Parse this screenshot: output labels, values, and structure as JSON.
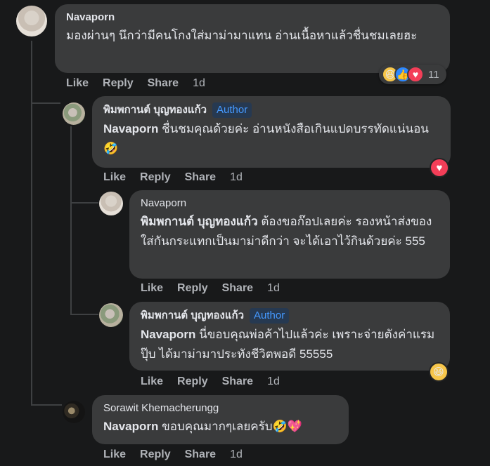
{
  "actions": {
    "like": "Like",
    "reply": "Reply",
    "share": "Share"
  },
  "comments": [
    {
      "author": "Navaporn",
      "text": "มองผ่านๆ นึกว่ามีคนโกงใส่มาม่ามาแทน อ่านเนื้อหาแล้วชื่นชมเลยฮะ",
      "time": "1d",
      "reaction_count": "11",
      "reactions": [
        "haha",
        "like",
        "love"
      ]
    },
    {
      "author": "พิมพกานต์ บุญทองแก้ว",
      "badge": "Author",
      "mention": "Navaporn",
      "text": " ชื่นชมคุณด้วยค่ะ อ่านหนังสือเกินแปดบรรทัดแน่นอน ",
      "emoji": "🤣",
      "time": "1d",
      "reactions": [
        "love"
      ]
    },
    {
      "author": "Navaporn",
      "mention": "พิมพกานต์ บุญทองแก้ว",
      "text": " ต้องขอก๊อปเลยค่ะ รองหน้าส่งของใส่กันกระแทกเป็นมาม่าดีกว่า จะได้เอาไว้กินด้วยค่ะ 555",
      "time": "1d"
    },
    {
      "author": "พิมพกานต์ บุญทองแก้ว",
      "badge": "Author",
      "mention": "Navaporn",
      "text": " นี่ขอบคุณพ่อค้าไปแล้วค่ะ เพราะจ่ายตังค่าแรมปุ๊บ ได้มาม่ามาประทังชีวิตพอดี 55555",
      "time": "1d",
      "reactions": [
        "haha"
      ]
    },
    {
      "author": "Sorawit Khemacherungg",
      "mention": "Navaporn",
      "text": " ขอบคุณมากๆเลยครับ",
      "emoji": "🤣💖",
      "time": "1d"
    }
  ],
  "icons": {
    "haha": "😆",
    "like": "👍",
    "love": "♥"
  },
  "colors": {
    "background": "#18191a",
    "bubble": "#3a3b3c",
    "text": "#e4e6eb",
    "muted": "#b0b3b8",
    "author_badge": "#4599ff",
    "like": "#2d88ff",
    "love": "#f33e58",
    "haha": "#f7c64a"
  }
}
